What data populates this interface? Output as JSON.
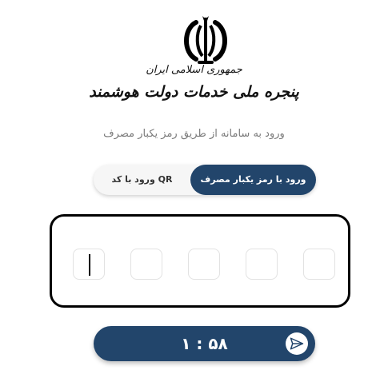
{
  "brand": {
    "emblem_icon": "iran-emblem-icon",
    "line1": "جمهوری اسلامی ایران",
    "line2": "پنجره ملی خدمات دولت هوشمند"
  },
  "login": {
    "subtitle": "ورود به سامانه از طریق رمز یکبار مصرف",
    "tabs": {
      "otp_label": "ورود با رمز یکبار مصرف",
      "qr_label": "ورود با کد QR",
      "active": "otp"
    },
    "otp": {
      "digit_count": 5,
      "values": [
        "",
        "",
        "",
        "",
        ""
      ]
    },
    "timer": {
      "value": "۱ : ۵۸",
      "icon": "send-icon"
    }
  },
  "colors": {
    "primary": "#22456b",
    "subtitle_text": "#7a7a7a",
    "frame_border": "#000000"
  }
}
